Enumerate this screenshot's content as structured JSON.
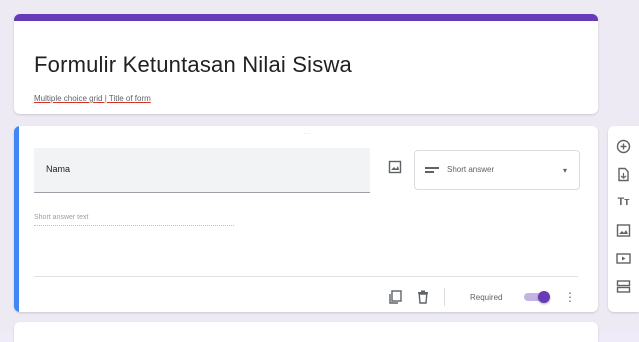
{
  "form": {
    "title": "Formulir Ketuntasan Nilai Siswa",
    "description": "Multiple choice grid | Title of form",
    "accent_color": "#673ab7"
  },
  "question": {
    "title_value": "Nama",
    "type_label": "Short answer",
    "answer_placeholder": "Short answer text",
    "required_label": "Required",
    "required_on": true
  },
  "side_toolbar": {
    "items": [
      "add-question-icon",
      "import-questions-icon",
      "add-title-icon",
      "add-image-icon",
      "add-video-icon",
      "add-section-icon"
    ]
  }
}
